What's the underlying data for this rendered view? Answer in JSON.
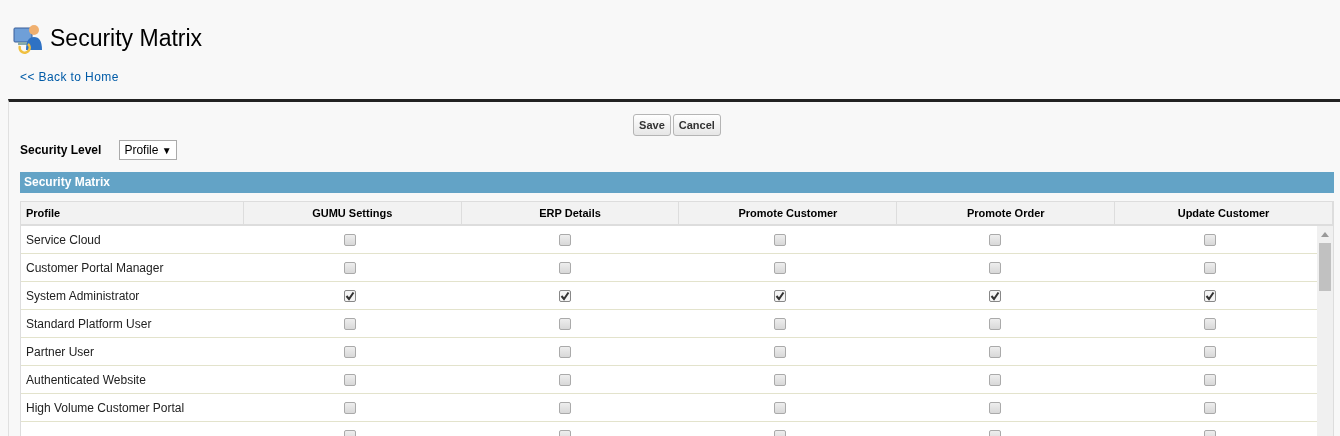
{
  "page": {
    "title": "Security Matrix",
    "back_link": "<< Back to Home"
  },
  "buttons": [
    "Save",
    "Cancel"
  ],
  "security_level": {
    "label": "Security Level",
    "value": "Profile",
    "caret": "▼"
  },
  "matrix": {
    "title": "Security Matrix",
    "columns": [
      "Profile",
      "GUMU Settings",
      "ERP Details",
      "Promote Customer",
      "Promote Order",
      "Update Customer"
    ],
    "rows": [
      {
        "profile": "Service Cloud",
        "checks": [
          false,
          false,
          false,
          false,
          false
        ]
      },
      {
        "profile": "Customer Portal Manager",
        "checks": [
          false,
          false,
          false,
          false,
          false
        ]
      },
      {
        "profile": "System Administrator",
        "checks": [
          true,
          true,
          true,
          true,
          true
        ]
      },
      {
        "profile": "Standard Platform User",
        "checks": [
          false,
          false,
          false,
          false,
          false
        ]
      },
      {
        "profile": "Partner User",
        "checks": [
          false,
          false,
          false,
          false,
          false
        ]
      },
      {
        "profile": "Authenticated Website",
        "checks": [
          false,
          false,
          false,
          false,
          false
        ]
      },
      {
        "profile": "High Volume Customer Portal",
        "checks": [
          false,
          false,
          false,
          false,
          false
        ]
      },
      {
        "checks": [
          false,
          false,
          false,
          false,
          false
        ]
      }
    ]
  }
}
